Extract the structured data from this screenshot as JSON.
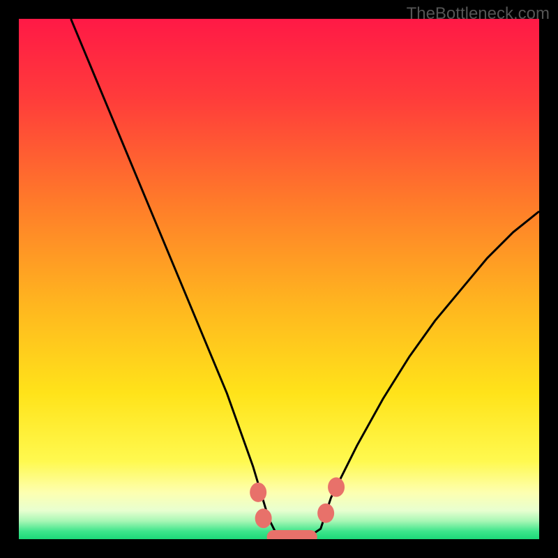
{
  "watermark": "TheBottleneck.com",
  "chart_data": {
    "type": "line",
    "title": "",
    "xlabel": "",
    "ylabel": "",
    "xlim": [
      0,
      100
    ],
    "ylim": [
      0,
      100
    ],
    "series": [
      {
        "name": "bottleneck-curve",
        "x": [
          10,
          15,
          20,
          25,
          30,
          35,
          40,
          45,
          48,
          50,
          52,
          55,
          58,
          60,
          65,
          70,
          75,
          80,
          85,
          90,
          95,
          100
        ],
        "values": [
          100,
          88,
          76,
          64,
          52,
          40,
          28,
          14,
          4,
          0,
          0,
          0,
          2,
          8,
          18,
          27,
          35,
          42,
          48,
          54,
          59,
          63
        ]
      }
    ],
    "markers": [
      {
        "name": "bead-left-1",
        "x": 46,
        "y": 9
      },
      {
        "name": "bead-left-2",
        "x": 47,
        "y": 4
      },
      {
        "name": "flat-start",
        "x": 49,
        "y": 0
      },
      {
        "name": "flat-end",
        "x": 56,
        "y": 0
      },
      {
        "name": "bead-right-1",
        "x": 59,
        "y": 5
      },
      {
        "name": "bead-right-2",
        "x": 61,
        "y": 10
      }
    ],
    "gradient_stops": [
      {
        "offset": 0.0,
        "color": "#ff1946"
      },
      {
        "offset": 0.15,
        "color": "#ff3b3b"
      },
      {
        "offset": 0.35,
        "color": "#ff7a2a"
      },
      {
        "offset": 0.55,
        "color": "#ffb61f"
      },
      {
        "offset": 0.72,
        "color": "#ffe31a"
      },
      {
        "offset": 0.85,
        "color": "#fff94f"
      },
      {
        "offset": 0.91,
        "color": "#fdffb0"
      },
      {
        "offset": 0.945,
        "color": "#e8ffd0"
      },
      {
        "offset": 0.965,
        "color": "#a8f7b5"
      },
      {
        "offset": 0.985,
        "color": "#3de58b"
      },
      {
        "offset": 1.0,
        "color": "#1cd878"
      }
    ],
    "marker_color": "#e8716a",
    "curve_color": "#000000"
  }
}
